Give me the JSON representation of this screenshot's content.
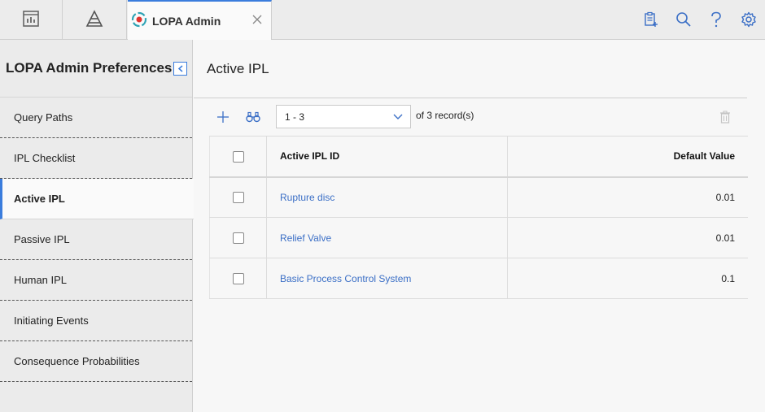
{
  "tab": {
    "title": "LOPA Admin"
  },
  "sidebar": {
    "title": "LOPA Admin Preferences",
    "items": [
      {
        "label": "Query Paths"
      },
      {
        "label": "IPL Checklist"
      },
      {
        "label": "Active IPL"
      },
      {
        "label": "Passive IPL"
      },
      {
        "label": "Human IPL"
      },
      {
        "label": "Initiating Events"
      },
      {
        "label": "Consequence Probabilities"
      }
    ],
    "active_index": 2
  },
  "main": {
    "title": "Active IPL",
    "pager": {
      "value": "1 - 3",
      "of_label": "of",
      "total": "3",
      "records_label": "record(s)"
    },
    "table": {
      "columns": [
        "Active IPL ID",
        "Default Value"
      ],
      "rows": [
        {
          "id": "Rupture disc",
          "value": "0.01"
        },
        {
          "id": "Relief Valve",
          "value": "0.01"
        },
        {
          "id": "Basic Process Control System",
          "value": "0.1"
        }
      ]
    }
  },
  "colors": {
    "accent": "#3b7ddd",
    "link": "#3b6fc6"
  }
}
